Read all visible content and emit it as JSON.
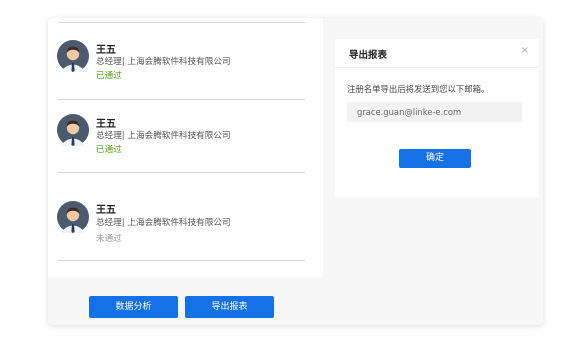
{
  "contacts": [
    {
      "name": "王五",
      "title": "总经理| 上海会腾软件科技有限公司",
      "status": "已通过",
      "status_type": "pass"
    },
    {
      "name": "王五",
      "title": "总经理| 上海会腾软件科技有限公司",
      "status": "已通过",
      "status_type": "pass"
    },
    {
      "name": "王五",
      "title": "总经理| 上海会腾软件科技有限公司",
      "status": "未通过",
      "status_type": "fail"
    }
  ],
  "toolbar": {
    "data_analysis_label": "数据分析",
    "export_report_label": "导出报表"
  },
  "dialog": {
    "title": "导出报表",
    "close_icon": "×",
    "description": "注册名单导出后将发送到您以下邮箱。",
    "email_value": "grace.guan@linke-e.com",
    "confirm_label": "确定"
  },
  "colors": {
    "primary": "#1572e6",
    "pass": "#52a30a",
    "fail": "#999999",
    "panel_bg": "#f7f7f7"
  }
}
